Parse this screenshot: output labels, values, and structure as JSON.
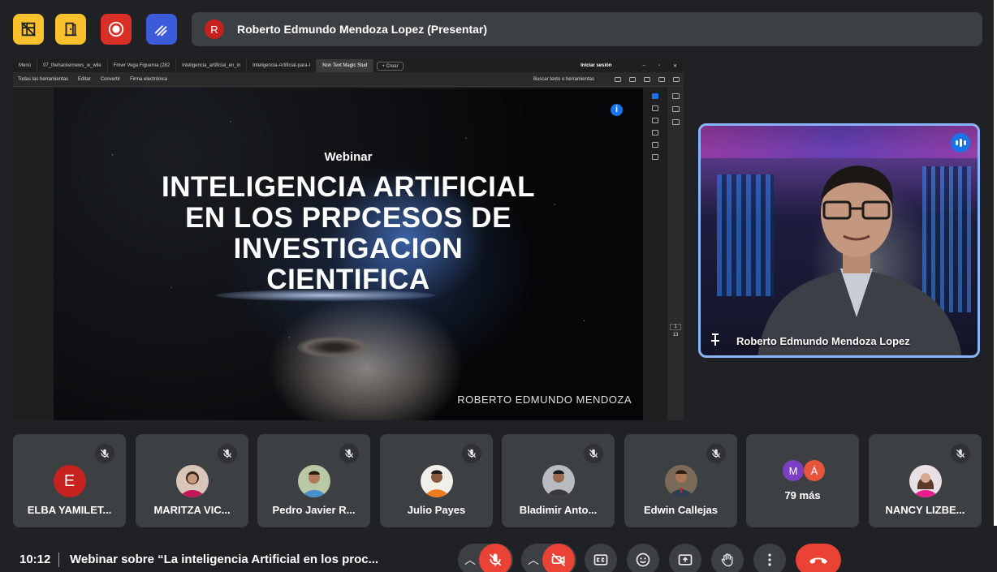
{
  "header": {
    "presenter_initial": "R",
    "presenter_label": "Roberto Edmundo Mendoza Lopez (Presentar)"
  },
  "browser": {
    "tabs": [
      {
        "label": "Menú"
      },
      {
        "label": "07_thehackernews_w_wile"
      },
      {
        "label": "Fmwr Vega Figueroa (282"
      },
      {
        "label": "Inteligencia_artificial_en_in"
      },
      {
        "label": "Inteligencia-Artificial-para-I"
      },
      {
        "label": "Non Text Magic Stud"
      }
    ],
    "new_tab": "+ Crear",
    "sign_in": "Iniciar sesión"
  },
  "acrobat": {
    "menu": [
      "Todas las herramientas",
      "Editar",
      "Convertir",
      "Firma electrónica"
    ],
    "search": "Buscar texto o herramientas",
    "page_current": "1",
    "page_total": "13"
  },
  "slide": {
    "kicker": "Webinar",
    "title_lines": [
      "INTELIGENCIA ARTIFICIAL",
      "EN LOS PRPCESOS DE",
      "INVESTIGACION",
      "CIENTIFICA"
    ],
    "author": "ROBERTO EDMUNDO MENDOZA",
    "info_glyph": "i"
  },
  "speaker": {
    "name": "Roberto Edmundo Mendoza Lopez"
  },
  "participants": [
    {
      "name": "ELBA YAMILET...",
      "initial": "E",
      "color": "#c5221f"
    },
    {
      "name": "MARITZA VIC...",
      "initial": "",
      "color": "#d9c6b8"
    },
    {
      "name": "Pedro Javier R...",
      "initial": "",
      "color": "#b9c9a6"
    },
    {
      "name": "Julio Payes",
      "initial": "",
      "color": "#ef8a2e"
    },
    {
      "name": "Bladimir Anto...",
      "initial": "",
      "color": "#aab0b6"
    },
    {
      "name": "Edwin Callejas",
      "initial": "",
      "color": "#8a7a6a"
    },
    {
      "name": "NANCY LIZBE...",
      "initial": "",
      "color": "#e0b6c8"
    }
  ],
  "more": {
    "label": "79 más",
    "initials": [
      "M",
      "Á"
    ],
    "colors": [
      "#7b3fc4",
      "#e8553d"
    ]
  },
  "footer": {
    "time": "10:12",
    "meeting_title": "Webinar sobre “La inteligencia Artificial en los proc..."
  }
}
